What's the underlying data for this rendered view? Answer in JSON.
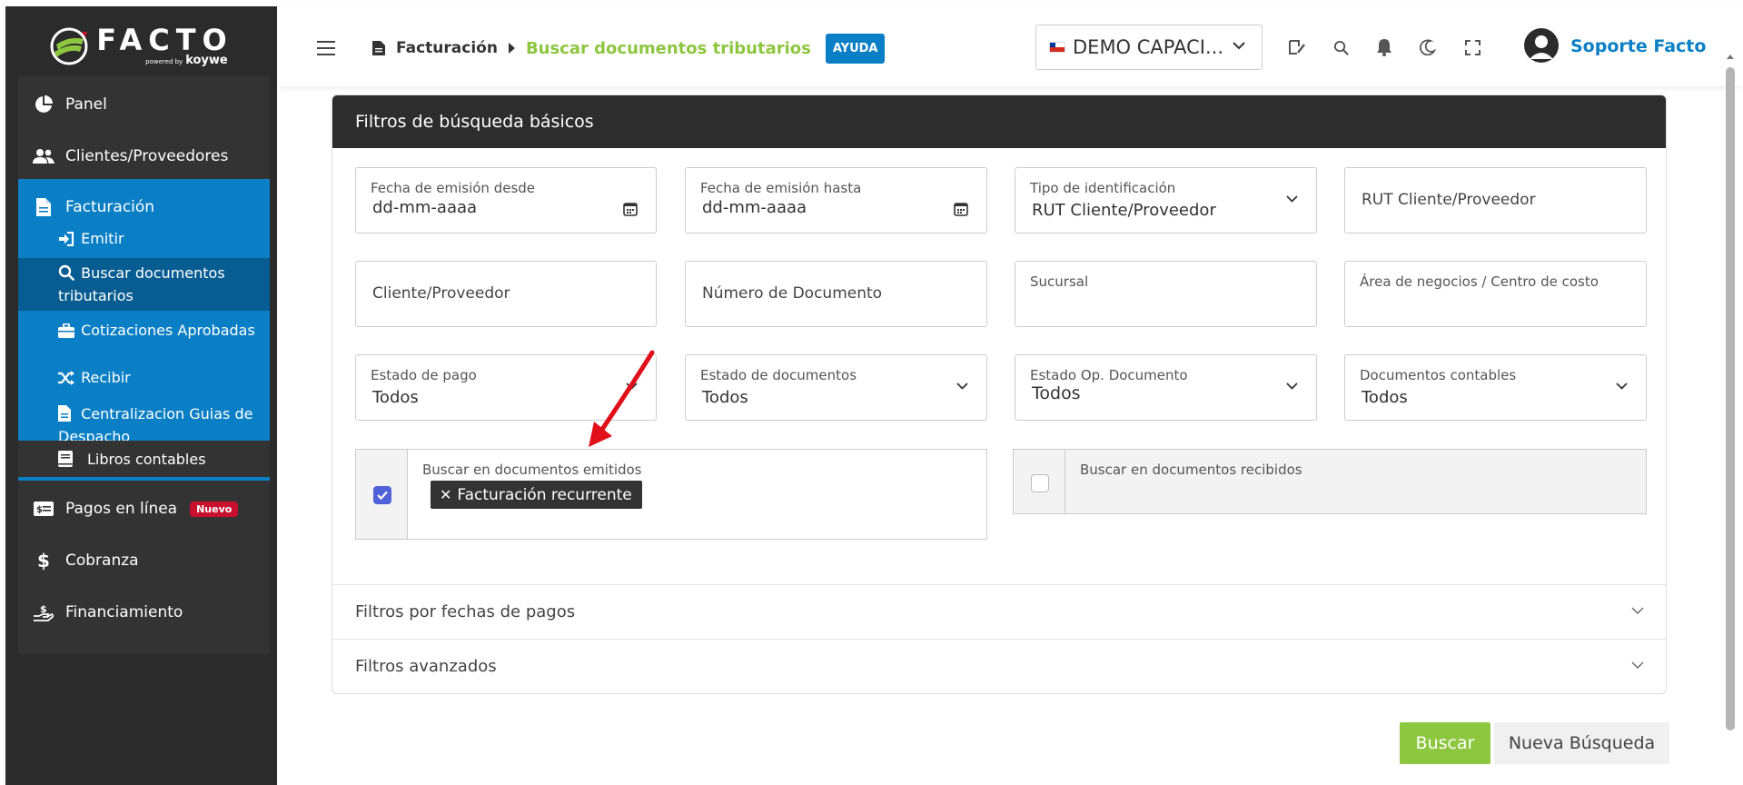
{
  "sidebar": {
    "logo": {
      "word": "FACTO",
      "powered": "powered by",
      "brand": "koywe"
    },
    "items": [
      {
        "label": "Panel",
        "icon": "pie-chart-icon"
      },
      {
        "label": "Clientes/Proveedores",
        "icon": "users-icon"
      },
      {
        "label": "Facturación",
        "icon": "file-icon"
      },
      {
        "label": "Libros contables",
        "icon": "book-icon"
      },
      {
        "label": "Pagos en línea",
        "icon": "money-card-icon",
        "badge": "Nuevo"
      },
      {
        "label": "Cobranza",
        "icon": "dollar-icon"
      },
      {
        "label": "Financiamiento",
        "icon": "hand-coin-icon"
      }
    ],
    "facturacion_sub": [
      {
        "label": "Emitir",
        "icon": "sign-in-icon"
      },
      {
        "label": "Buscar documentos tributarios",
        "icon": "search-icon"
      },
      {
        "label": "Cotizaciones Aprobadas",
        "icon": "briefcase-icon"
      },
      {
        "label": "Recibir",
        "icon": "shuffle-icon"
      },
      {
        "label": "Centralizacion Guias de Despacho",
        "icon": "file-text-icon"
      }
    ]
  },
  "header": {
    "breadcrumb_parent": "Facturación",
    "breadcrumb_current": "Buscar documentos tributarios",
    "help_label": "AYUDA",
    "company": "DEMO CAPACI...",
    "user_name": "Soporte Facto"
  },
  "filters": {
    "title": "Filtros de búsqueda básicos",
    "fecha_desde": {
      "label": "Fecha de emisión desde",
      "value": "dd-mm-aaaa"
    },
    "fecha_hasta": {
      "label": "Fecha de emisión hasta",
      "value": "dd-mm-aaaa"
    },
    "tipo_id": {
      "label": "Tipo de identificación",
      "value": "RUT Cliente/Proveedor"
    },
    "rut": {
      "placeholder": "RUT Cliente/Proveedor"
    },
    "cliente": {
      "placeholder": "Cliente/Proveedor"
    },
    "numero": {
      "placeholder": "Número de Documento"
    },
    "sucursal": {
      "label": "Sucursal"
    },
    "area": {
      "label": "Área de negocios / Centro de costo"
    },
    "estado_pago": {
      "label": "Estado de pago",
      "value": "Todos"
    },
    "estado_docs": {
      "label": "Estado de documentos",
      "value": "Todos"
    },
    "estado_op": {
      "label": "Estado Op. Documento",
      "value": "Todos"
    },
    "docs_contables": {
      "label": "Documentos contables",
      "value": "Todos"
    },
    "emitidos": {
      "label": "Buscar en documentos emitidos",
      "checked": true,
      "tag": "Facturación recurrente"
    },
    "recibidos": {
      "label": "Buscar en documentos recibidos",
      "checked": false
    }
  },
  "sections": {
    "fechas_pagos": "Filtros por fechas de pagos",
    "avanzados": "Filtros avanzados"
  },
  "actions": {
    "search": "Buscar",
    "new_search": "Nueva Búsqueda"
  },
  "colors": {
    "brand_blue": "#0b7fc5",
    "brand_green": "#8dc63f",
    "sidebar_dark": "#2b2b2b",
    "annotation_red": "#e0101b"
  }
}
